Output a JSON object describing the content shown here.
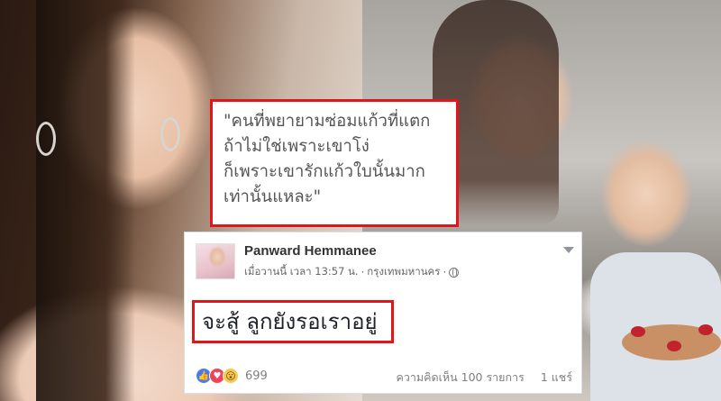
{
  "quote": {
    "lines": "\"คนที่พยายามซ่อมแก้วที่แตก\nถ้าไม่ใช่เพราะเขาโง่\nก็เพราะเขารักแก้วใบนั้นมาก\nเท่านั้นแหละ\""
  },
  "post": {
    "author": "Panward Hemmanee",
    "timestamp": "เมื่อวานนี้ เวลา 13:57 น.",
    "location": "กรุงเทพมหานคร",
    "separator": "·",
    "status": "จะสู้ ลูกยังรอเราอยู่",
    "reactions": {
      "icons": [
        "like-icon",
        "love-icon",
        "wow-icon"
      ],
      "count": "699"
    },
    "comments": "ความคิดเห็น 100 รายการ",
    "shares": "1 แชร์"
  },
  "colors": {
    "highlight_border": "#e0161b",
    "like": "#4a7ce8",
    "love": "#f0435b",
    "wow": "#f7c94c"
  }
}
